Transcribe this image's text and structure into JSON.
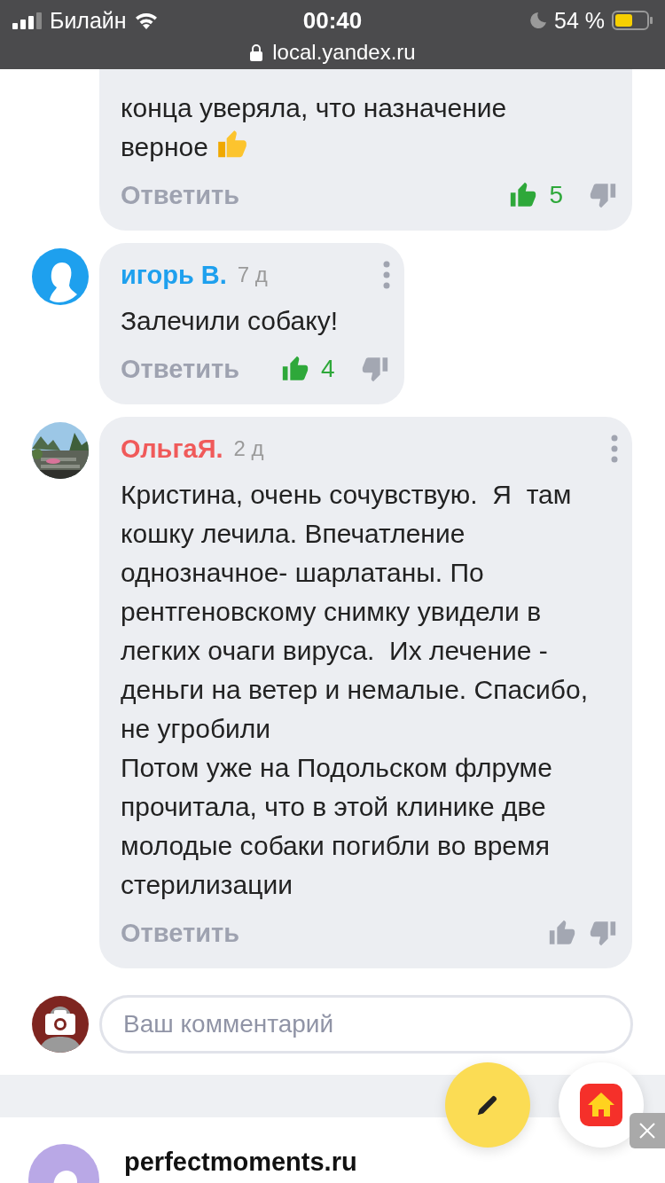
{
  "status_bar": {
    "carrier": "Билайн",
    "time": "00:40",
    "battery": "54 %"
  },
  "address_bar": {
    "url": "local.yandex.ru"
  },
  "comments": [
    {
      "kind": "partial",
      "lines": [
        "конца уверяла, что назначение",
        "верное"
      ],
      "reply": "Ответить",
      "likes": "5",
      "liked": true,
      "disliked": false
    },
    {
      "kind": "full",
      "author": "игорь В.",
      "color": "#1ea0ee",
      "age": "7 д",
      "text": "Залечили собаку!",
      "reply": "Ответить",
      "likes": "4",
      "liked": true,
      "disliked": false
    },
    {
      "kind": "full",
      "author": "ОльгаЯ.",
      "color": "#f05a5a",
      "age": "2 д",
      "text": "Кристина, очень сочувствую.  Я  там кошку лечила. Впечатление однозначное- шарлатаны. По рентгеновскому снимку увидели в легких очаги вируса.  Их лечение - деньги на ветер и немалые. Спасибо, не угробили\nПотом уже на Подольском флруме прочитала, что в этой клинике две молодые собаки погибли во время стерилизации",
      "reply": "Ответить",
      "liked": false,
      "disliked": false
    }
  ],
  "composer": {
    "placeholder": "Ваш комментарий"
  },
  "next_item": {
    "title": "perfectmoments.ru"
  }
}
